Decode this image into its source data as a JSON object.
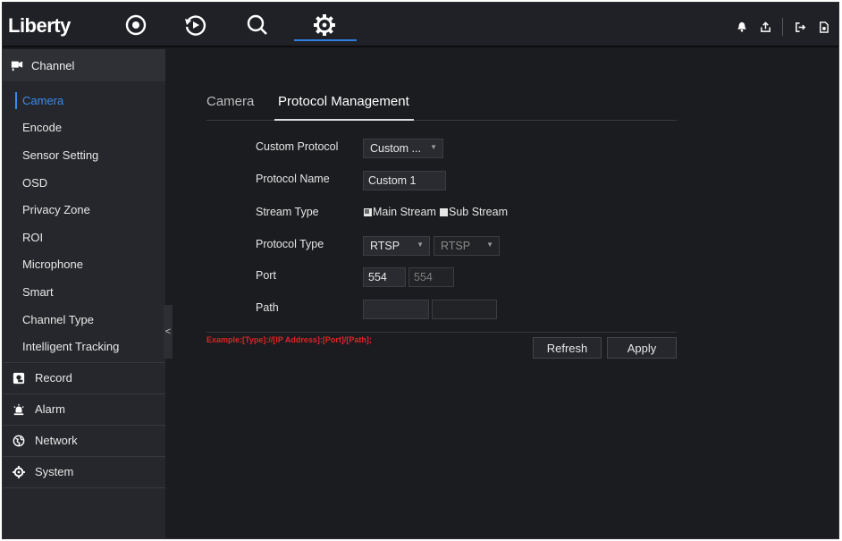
{
  "app": {
    "logo": "Liberty"
  },
  "topbar": {
    "nav_icons": [
      "live-view-icon",
      "playback-icon",
      "search-icon",
      "settings-icon"
    ],
    "active_nav": "settings-icon",
    "right_icons": [
      "bell-icon",
      "export-icon",
      "logout-icon",
      "info-file-icon"
    ]
  },
  "sidebar": {
    "channel_label": "Channel",
    "sub_items": [
      {
        "label": "Camera",
        "active": true
      },
      {
        "label": "Encode"
      },
      {
        "label": "Sensor Setting"
      },
      {
        "label": "OSD"
      },
      {
        "label": "Privacy Zone"
      },
      {
        "label": "ROI"
      },
      {
        "label": "Microphone"
      },
      {
        "label": "Smart"
      },
      {
        "label": "Channel Type"
      },
      {
        "label": "Intelligent Tracking"
      }
    ],
    "groups": [
      {
        "label": "Record",
        "icon": "record-icon"
      },
      {
        "label": "Alarm",
        "icon": "alarm-icon"
      },
      {
        "label": "Network",
        "icon": "network-icon"
      },
      {
        "label": "System",
        "icon": "system-icon"
      }
    ],
    "collapse_glyph": "<"
  },
  "tabs": {
    "camera": "Camera",
    "protocol_management": "Protocol Management"
  },
  "form": {
    "custom_protocol": {
      "label": "Custom Protocol",
      "value": "Custom ..."
    },
    "protocol_name": {
      "label": "Protocol Name",
      "value": "Custom 1"
    },
    "stream_type": {
      "label": "Stream Type",
      "main": "Main Stream",
      "sub": "Sub Stream"
    },
    "protocol_type": {
      "label": "Protocol Type",
      "main_value": "RTSP",
      "sub_value": "RTSP"
    },
    "port": {
      "label": "Port",
      "main_value": "554",
      "sub_value": "554"
    },
    "path": {
      "label": "Path",
      "main_value": "",
      "sub_value": ""
    },
    "example": "Example:[Type]://[IP Address]:[Port]/[Path];"
  },
  "buttons": {
    "refresh": "Refresh",
    "apply": "Apply"
  },
  "colors": {
    "accent": "#2f7fe0",
    "example_text": "#e02424",
    "background": "#1b1c20"
  }
}
